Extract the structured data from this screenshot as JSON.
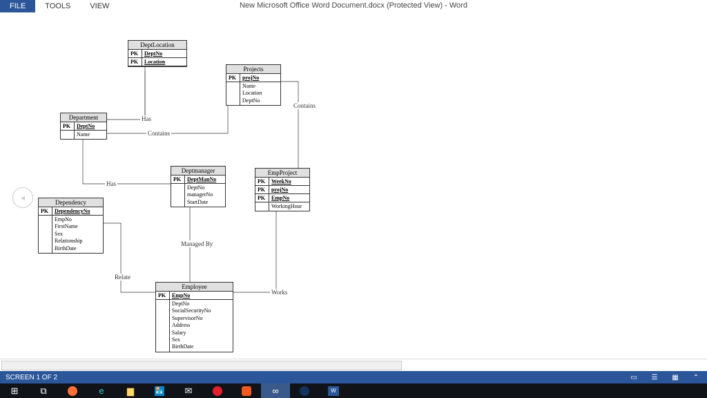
{
  "ribbon": {
    "tabs": [
      {
        "label": "FILE",
        "active": true
      },
      {
        "label": "TOOLS",
        "active": false
      },
      {
        "label": "VIEW",
        "active": false
      }
    ]
  },
  "title": "New Microsoft Office Word Document.docx (Protected View) - Word",
  "statusbar": {
    "screen_label": "SCREEN 1 OF 2"
  },
  "nav_glyph": "◂",
  "view_icons": [
    "read-mode",
    "print-layout",
    "web-layout",
    "expand"
  ],
  "diagram": {
    "entities": {
      "deptlocation": {
        "title": "DeptLocation",
        "pks": [
          "DeptNo",
          "Location"
        ],
        "attrs": []
      },
      "projects": {
        "title": "Projects",
        "pks": [
          "projNo"
        ],
        "attrs": [
          "Name",
          "Location",
          "DeptNo"
        ]
      },
      "department": {
        "title": "Department",
        "pks": [
          "DeptNo"
        ],
        "attrs": [
          "Name"
        ]
      },
      "deptmanager": {
        "title": "Deptmanager",
        "pks": [
          "DeptManNo"
        ],
        "attrs": [
          "DeptNo",
          "managerNo",
          "StartDate"
        ]
      },
      "empproject": {
        "title": "EmpProject",
        "pks": [
          "WeekNo",
          "projNo",
          "EmpNo"
        ],
        "attrs": [
          "WorkingHour"
        ]
      },
      "dependency": {
        "title": "Dependency",
        "pks": [
          "DependencyNo"
        ],
        "attrs": [
          "EmpNo",
          "FirstName",
          "Sex",
          "Relationship",
          "BirthDate"
        ]
      },
      "employee": {
        "title": "Employee",
        "pks": [
          "EmpNo"
        ],
        "attrs": [
          "DeptNo",
          "SocialSecurityNo",
          "SupervisorNo",
          "Address",
          "Salary",
          "Sex",
          "BirthDate"
        ]
      }
    },
    "relationships": {
      "has1": "Has",
      "contains1": "Contains",
      "contains2": "Contains",
      "has2": "Has",
      "managedby": "Managed By",
      "relate": "Relate",
      "works": "Works"
    }
  },
  "taskbar_items": [
    "start",
    "taskview",
    "firefox",
    "edge",
    "explorer",
    "store",
    "mail",
    "opera",
    "brave",
    "app1",
    "app2",
    "word"
  ]
}
